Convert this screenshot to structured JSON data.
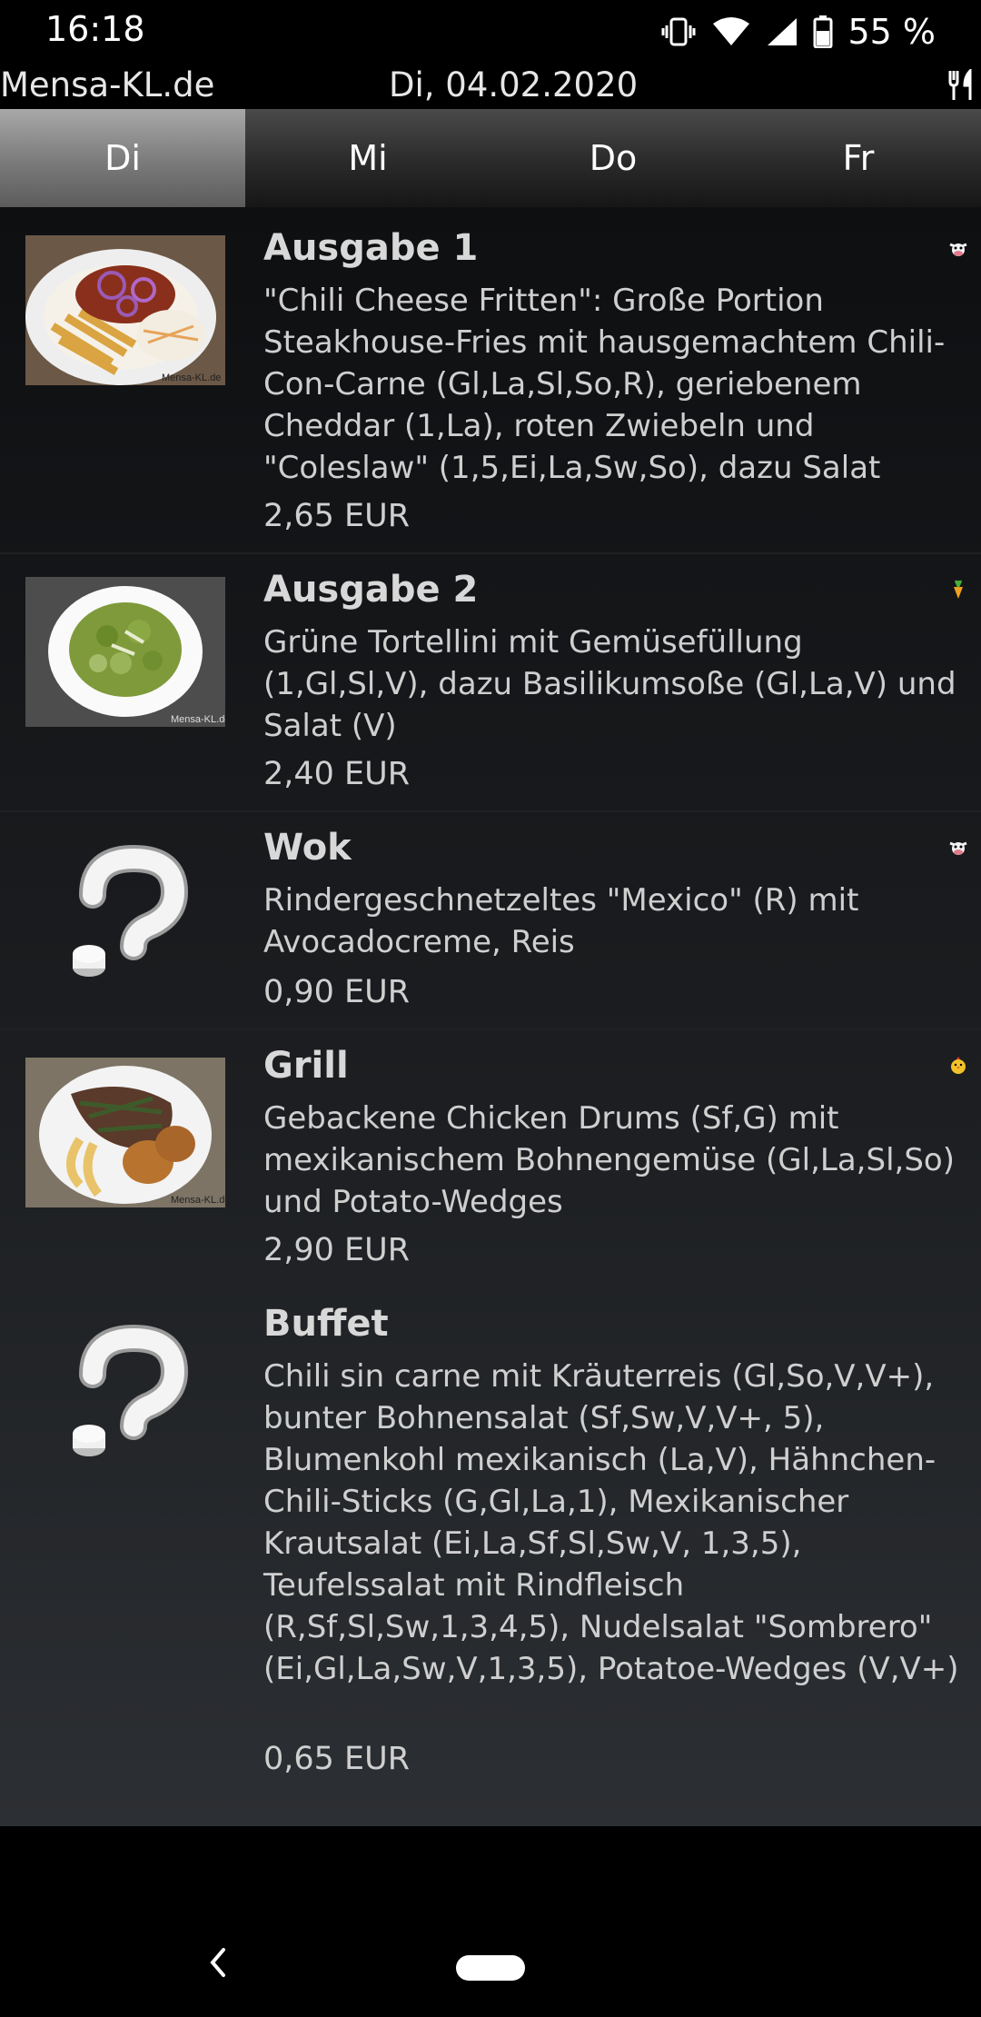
{
  "status": {
    "time": "16:18",
    "battery": "55 %"
  },
  "header": {
    "app_name": "Mensa-KL.de",
    "date": "Di, 04.02.2020",
    "icon": "cutlery-icon"
  },
  "tabs": [
    {
      "label": "Di",
      "active": true
    },
    {
      "label": "Mi",
      "active": false
    },
    {
      "label": "Do",
      "active": false
    },
    {
      "label": "Fr",
      "active": false
    }
  ],
  "items": [
    {
      "title": "Ausgabe 1",
      "description": "\"Chili Cheese Fritten\": Große Portion Steakhouse-Fries mit hausgemachtem Chili-Con-Carne (Gl,La,Sl,So,R), geriebenem Cheddar (1,La), roten Zwiebeln und \"Coleslaw\" (1,5,Ei,La,Sw,So), dazu Salat",
      "price": "2,65 EUR",
      "badge": "cow-icon",
      "photo_watermark": "Mensa-KL.de"
    },
    {
      "title": "Ausgabe 2",
      "description": "Grüne Tortellini mit Gemüsefüllung (1,Gl,Sl,V), dazu Basilikumsoße (Gl,La,V) und Salat (V)",
      "price": "2,40 EUR",
      "badge": "carrot-icon",
      "photo_watermark": "Mensa-KL.de"
    },
    {
      "title": "Wok",
      "description": "Rindergeschnetzeltes \"Mexico\" (R) mit Avocadocreme, Reis",
      "price": "0,90 EUR",
      "badge": "cow-icon"
    },
    {
      "title": "Grill",
      "description": "Gebackene Chicken Drums (Sf,G) mit mexikanischem Bohnengemüse (Gl,La,Sl,So) und Potato-Wedges",
      "price": "2,90 EUR",
      "badge": "chicken-icon",
      "photo_watermark": "Mensa-KL.de"
    },
    {
      "title": "Buffet",
      "description": "Chili sin carne mit Kräuterreis (Gl,So,V,V+), bunter Bohnensalat (Sf,Sw,V,V+, 5), Blumenkohl mexikanisch (La,V), Hähnchen-Chili-Sticks (G,Gl,La,1), Mexikanischer Krautsalat (Ei,La,Sf,Sl,Sw,V, 1,3,5), Teufelssalat mit Rindfleisch (R,Sf,Sl,Sw,1,3,4,5), Nudelsalat \"Sombrero\" (Ei,Gl,La,Sw,V,1,3,5), Potatoe-Wedges (V,V+)",
      "price": "0,65 EUR"
    }
  ],
  "nav": {
    "back_icon": "back-icon",
    "home_icon": "home-pill-icon"
  }
}
